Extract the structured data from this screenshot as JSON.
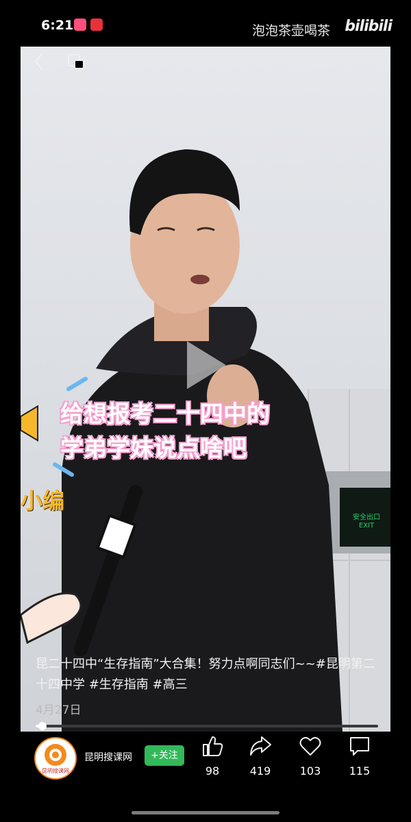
{
  "status_bar": {
    "time": "6:21"
  },
  "watermark": {
    "channel": "泡泡茶壶喝茶",
    "logo": "bilibili"
  },
  "video": {
    "overlay_line1": "给想报考二十四中的",
    "overlay_line2": "学弟学妹说点啥吧",
    "side_label": "小编",
    "exit_sign_cn": "安全出口",
    "exit_sign_en": "EXIT",
    "progress": 0.02
  },
  "post": {
    "caption": "昆二十四中“生存指南”大合集！努力点啊同志们~~#昆明第二十四中学 #生存指南 #高三",
    "date": "4月27日"
  },
  "author": {
    "name": "昆明搜课网",
    "avatar_text": "昆明搜课网",
    "follow_label": "+关注"
  },
  "actions": {
    "like_count": "98",
    "share_count": "419",
    "favorite_count": "103",
    "comment_count": "115"
  },
  "colors": {
    "follow_green": "#33b85a",
    "overlay_pink": "#f7a0cf",
    "avatar_orange": "#f28a1e"
  }
}
